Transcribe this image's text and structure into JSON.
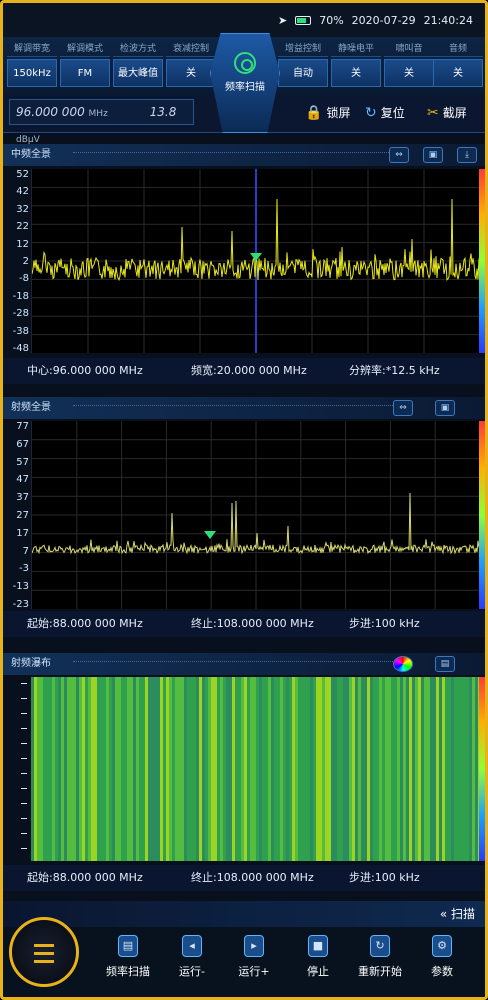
{
  "status": {
    "time_date": "2020-07-29",
    "time": "21:40:24",
    "battery_text": "70%",
    "battery_level": 0.7
  },
  "params_left": [
    {
      "label": "解调带宽",
      "value": "150kHz"
    },
    {
      "label": "解调模式",
      "value": "FM"
    },
    {
      "label": "检波方式",
      "value": "最大峰值"
    },
    {
      "label": "衰减控制",
      "value": "关"
    }
  ],
  "params_right": [
    {
      "label": "增益控制",
      "value": "自动"
    },
    {
      "label": "静噪电平",
      "value": "关"
    },
    {
      "label": "啸叫音",
      "value": "关"
    },
    {
      "label": "音频",
      "value": "关"
    }
  ],
  "hub": {
    "label": "频率扫描"
  },
  "freqbar": {
    "freq": "96.000 000",
    "freq_unit": "MHz",
    "level": "13.8",
    "level_unit": "dBμV",
    "lock": "锁屏",
    "reset": "复位",
    "screenshot": "截屏"
  },
  "if_panel": {
    "title": "中频全景",
    "yticks": [
      "52",
      "42",
      "32",
      "22",
      "12",
      "2",
      "-8",
      "-18",
      "-28",
      "-38",
      "-48"
    ],
    "center": "中心:96.000 000 MHz",
    "span": "频宽:20.000 000 MHz",
    "rbw": "分辨率:*12.5 kHz"
  },
  "rf_panel": {
    "title": "射频全景",
    "yticks": [
      "77",
      "67",
      "57",
      "47",
      "37",
      "27",
      "17",
      "7",
      "-3",
      "-13",
      "-23"
    ],
    "start": "起始:88.000 000 MHz",
    "stop": "终止:108.000 000 MHz",
    "step": "步进:100 kHz"
  },
  "waterfall": {
    "title": "射频瀑布",
    "start": "起始:88.000 000 MHz",
    "stop": "终止:108.000 000 MHz",
    "step": "步进:100 kHz"
  },
  "bottom": {
    "section": "扫描",
    "buttons": [
      "频率扫描",
      "运行-",
      "运行+",
      "停止",
      "重新开始",
      "参数"
    ]
  },
  "colors": {
    "accent": "#e8b21a",
    "trace_if": "#e6e61a",
    "trace_rf": "#d8d870",
    "marker": "#2fe07a"
  }
}
